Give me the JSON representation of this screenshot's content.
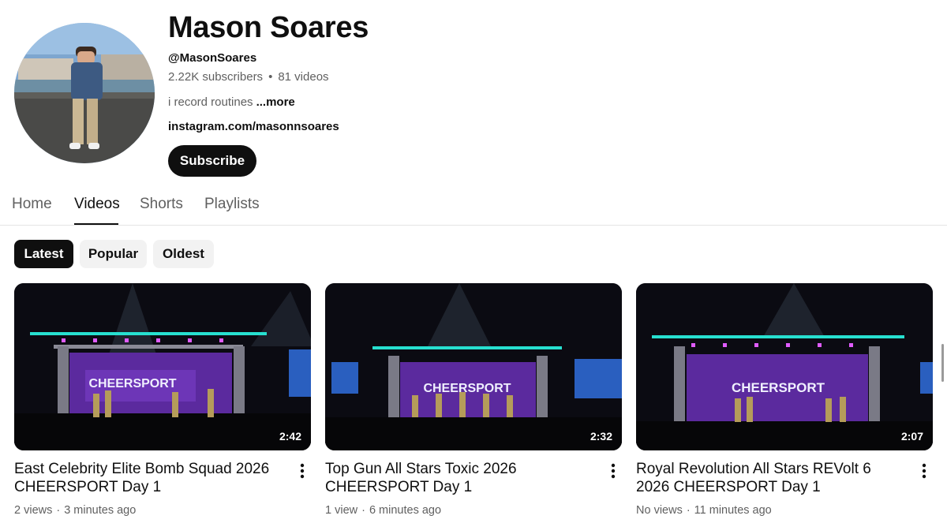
{
  "channel": {
    "name": "Mason Soares",
    "handle": "@MasonSoares",
    "subscribers": "2.22K subscribers",
    "videos_count": "81 videos",
    "description": "i record routines",
    "more_label": "...more",
    "link": "instagram.com/masonnsoares",
    "subscribe_label": "Subscribe"
  },
  "tabs": [
    {
      "label": "Home",
      "active": false
    },
    {
      "label": "Videos",
      "active": true
    },
    {
      "label": "Shorts",
      "active": false
    },
    {
      "label": "Playlists",
      "active": false
    }
  ],
  "filters": [
    {
      "label": "Latest",
      "active": true
    },
    {
      "label": "Popular",
      "active": false
    },
    {
      "label": "Oldest",
      "active": false
    }
  ],
  "videos": [
    {
      "title": "East Celebrity Elite Bomb Squad 2026 CHEERSPORT Day 1",
      "duration": "2:42",
      "views": "2 views",
      "age": "3 minutes ago"
    },
    {
      "title": "Top Gun All Stars Toxic 2026 CHEERSPORT Day 1",
      "duration": "2:32",
      "views": "1 view",
      "age": "6 minutes ago"
    },
    {
      "title": "Royal Revolution All Stars REVolt 6 2026 CHEERSPORT Day 1",
      "duration": "2:07",
      "views": "No views",
      "age": "11 minutes ago"
    }
  ],
  "colors": {
    "text": "#0f0f0f",
    "secondary_text": "#606060",
    "chip_bg": "#f2f2f2",
    "stage_purple": "#5b2a9e",
    "stage_teal": "#27e0d0",
    "stage_lights": "#e05cff"
  }
}
